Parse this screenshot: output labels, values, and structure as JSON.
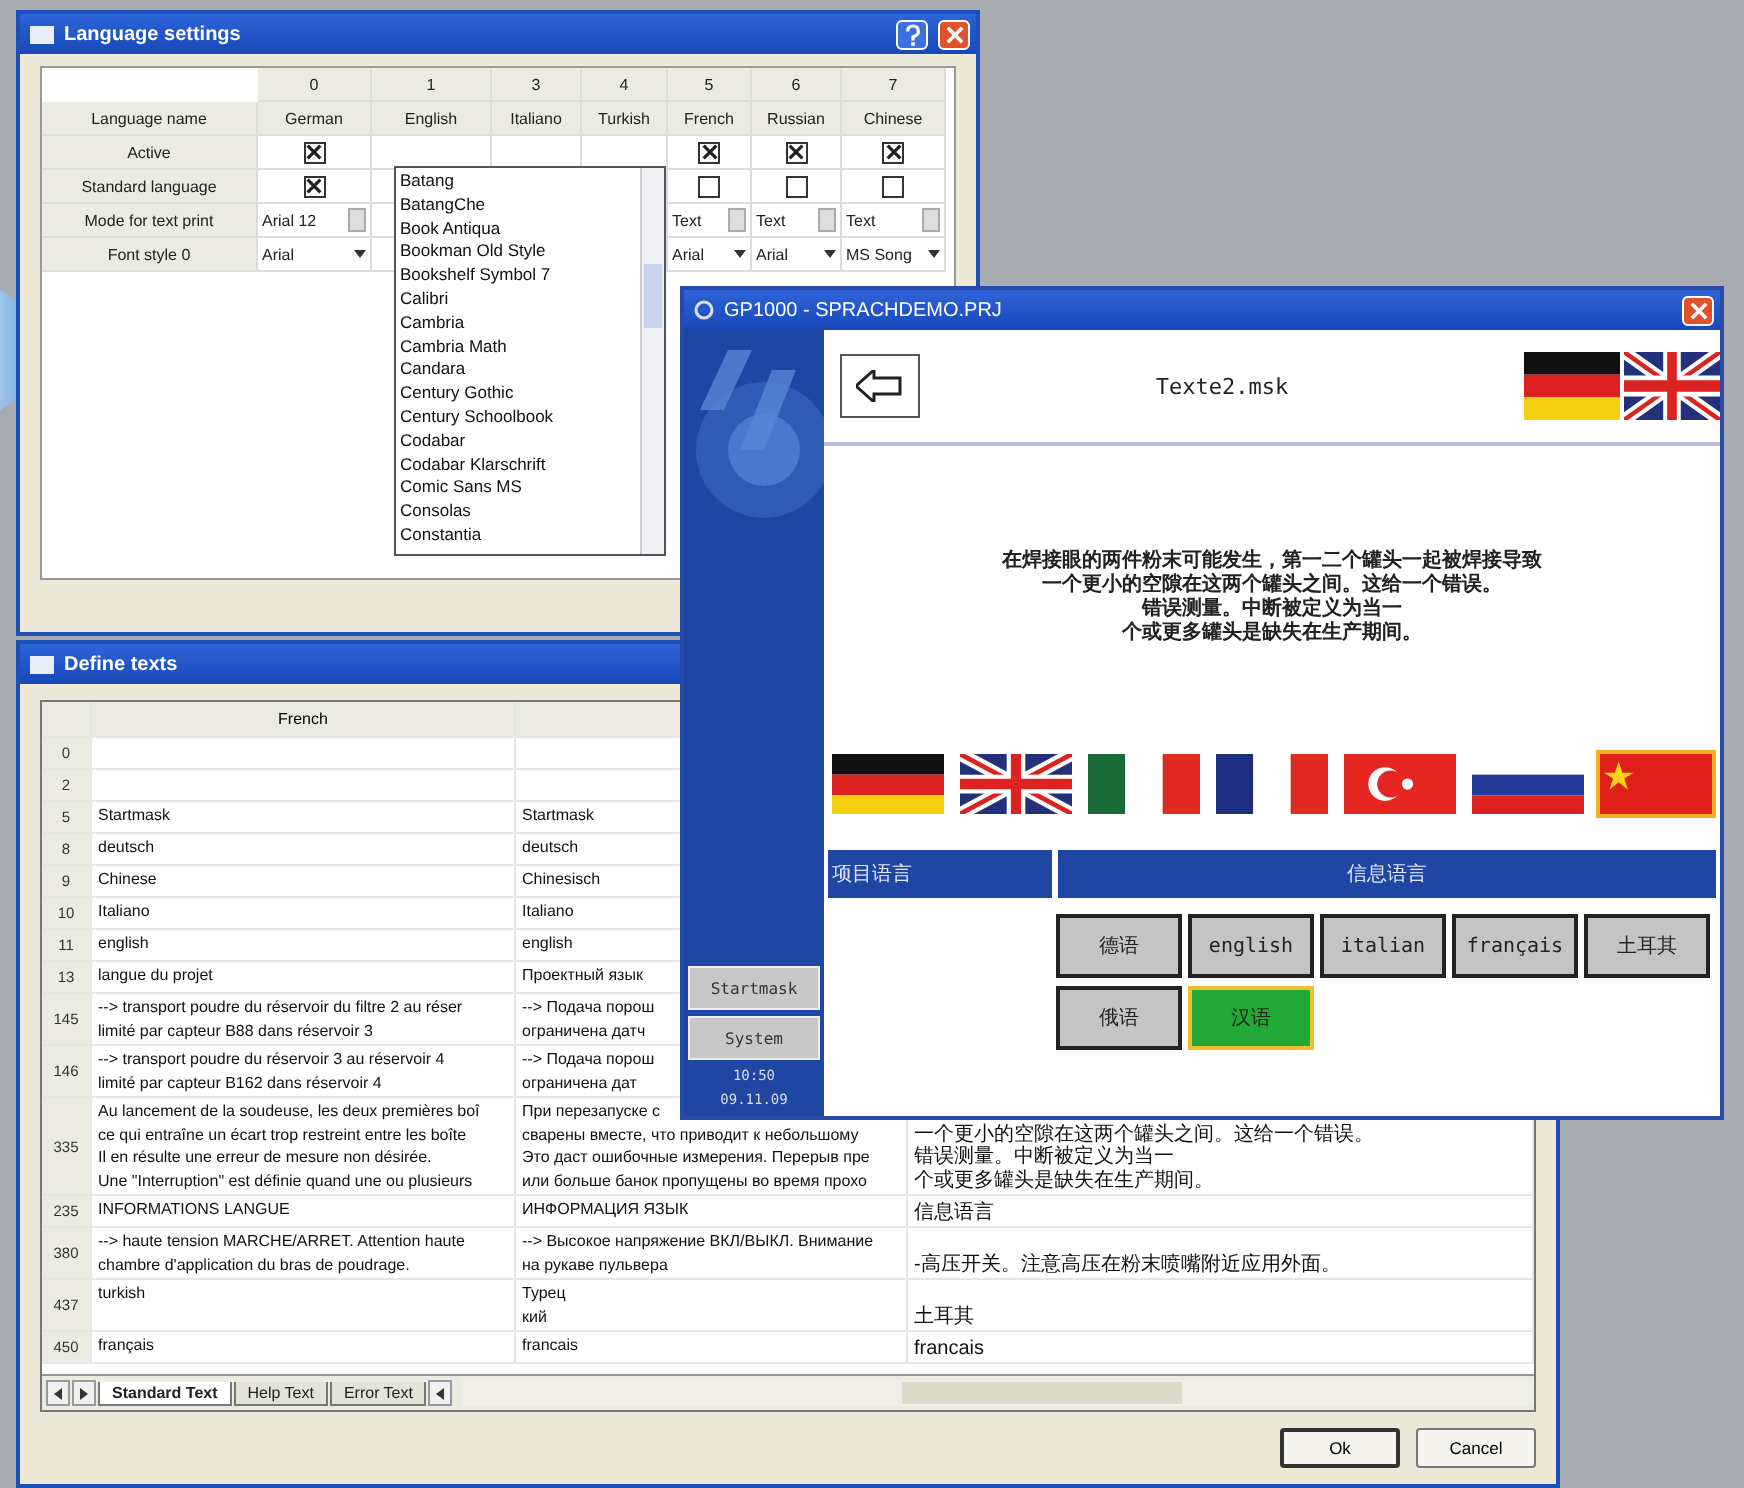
{
  "language_settings": {
    "title": "Language settings",
    "row_labels": [
      "Language name",
      "Active",
      "Standard language",
      "Mode for text print",
      "Font style 0"
    ],
    "columns": [
      {
        "number": "0",
        "name": "German",
        "active": true,
        "standard": true,
        "mode": "Arial 12",
        "font": "Arial"
      },
      {
        "number": "1",
        "name": "English"
      },
      {
        "number": "3",
        "name": "Italiano"
      },
      {
        "number": "4",
        "name": "Turkish"
      },
      {
        "number": "5",
        "name": "French",
        "active": true,
        "standard": false,
        "mode": "Text",
        "font": "Arial"
      },
      {
        "number": "6",
        "name": "Russian",
        "active": true,
        "standard": false,
        "mode": "Text",
        "font": "Arial"
      },
      {
        "number": "7",
        "name": "Chinese",
        "active": true,
        "standard": false,
        "mode": "Text",
        "font": "MS Song"
      }
    ],
    "font_list": [
      "Batang",
      "BatangChe",
      "Book Antiqua",
      "Bookman Old Style",
      "Bookshelf Symbol 7",
      "Calibri",
      "Cambria",
      "Cambria Math",
      "Candara",
      "Century Gothic",
      "Century Schoolbook",
      "Codabar",
      "Codabar Klarschrift",
      "Comic Sans MS",
      "Consolas",
      "Constantia"
    ]
  },
  "define_texts": {
    "title": "Define texts",
    "columns": [
      {
        "label": "French"
      }
    ],
    "rows": [
      {
        "number": "0",
        "cells": [
          [],
          [],
          []
        ]
      },
      {
        "number": "2",
        "cells": [
          [],
          [],
          []
        ]
      },
      {
        "number": "5",
        "cells": [
          [
            "Startmask"
          ],
          [
            "Startmask"
          ],
          []
        ]
      },
      {
        "number": "8",
        "cells": [
          [
            "deutsch"
          ],
          [
            "deutsch"
          ],
          []
        ]
      },
      {
        "number": "9",
        "cells": [
          [
            "Chinese"
          ],
          [
            "Chinesisch"
          ],
          []
        ]
      },
      {
        "number": "10",
        "cells": [
          [
            "Italiano"
          ],
          [
            "Italiano"
          ],
          []
        ]
      },
      {
        "number": "11",
        "cells": [
          [
            "english"
          ],
          [
            "english"
          ],
          []
        ]
      },
      {
        "number": "13",
        "cells": [
          [
            "langue du projet"
          ],
          [
            "Проектный язык"
          ],
          []
        ]
      },
      {
        "number": "145",
        "cells": [
          [
            "--> transport poudre du réservoir du filtre 2 au réser",
            "limité par capteur B88 dans réservoir 3"
          ],
          [
            "--> Подача порош",
            "ограничена датч"
          ],
          []
        ]
      },
      {
        "number": "146",
        "cells": [
          [
            "--> transport poudre du réservoir 3 au réservoir 4",
            "limité par capteur B162 dans réservoir 4"
          ],
          [
            "--> Подача порош",
            "ограничена дат"
          ],
          []
        ]
      },
      {
        "number": "335",
        "cells": [
          [
            "Au lancement de la soudeuse, les deux premières boî",
            "ce qui entraîne un écart trop restreint entre les boîte",
            "Il en résulte une erreur de mesure non désirée.",
            "Une \"Interruption\" est définie quand une ou plusieurs"
          ],
          [
            "При перезапуске с",
            "сварены вместе, что приводит к небольшому",
            "Это даст ошибочные измерения. Перерыв пре",
            "или больше банок пропущены во время прохо"
          ],
          [
            "一个更小的空隙在这两个罐头之间。这给一个错误。",
            "错误测量。中断被定义为当一",
            "个或更多罐头是缺失在生产期间。"
          ]
        ]
      },
      {
        "number": "235",
        "cells": [
          [
            "INFORMATIONS LANGUE"
          ],
          [
            "ИНФОРМАЦИЯ ЯЗЫК"
          ],
          [
            "信息语言"
          ]
        ]
      },
      {
        "number": "380",
        "cells": [
          [
            "--> haute tension MARCHE/ARRET. Attention haute",
            "chambre d'application du bras de poudrage."
          ],
          [
            "--> Высокое напряжение ВКЛ/ВЫКЛ. Внимание",
            "на рукаве пульвера"
          ],
          [
            "-高压开关。注意高压在粉末喷嘴附近应用外面。"
          ]
        ]
      },
      {
        "number": "437",
        "cells": [
          [
            "turkish"
          ],
          [
            "Турец",
            "кий"
          ],
          [
            "土耳其"
          ]
        ]
      },
      {
        "number": "450",
        "cells": [
          [
            "français"
          ],
          [
            "francais"
          ],
          [
            "francais"
          ]
        ]
      }
    ],
    "tabs": [
      {
        "label": "Standard Text",
        "selected": true
      },
      {
        "label": "Help Text",
        "selected": false
      },
      {
        "label": "Error Text",
        "selected": false
      }
    ],
    "buttons": [
      "Ok",
      "Cancel"
    ]
  },
  "gp1000": {
    "title": "GP1000 - SPRACHDEMO.PRJ",
    "side_buttons": [
      "Startmask",
      "System"
    ],
    "time": "10:50",
    "date": "09.11.09",
    "screen_title": "Texte2.msk",
    "header_flags": [
      {
        "kind": "de"
      },
      {
        "kind": "gb"
      }
    ],
    "message_lines": [
      "在焊接眼的两件粉末可能发生，第一二个罐头一起被焊接导致",
      "一个更小的空隙在这两个罐头之间。这给一个错误。",
      "错误测量。中断被定义为当一",
      "个或更多罐头是缺失在生产期间。"
    ],
    "flags": [
      {
        "kind": "de",
        "selected": false
      },
      {
        "kind": "gb",
        "selected": false
      },
      {
        "kind": "it",
        "selected": false
      },
      {
        "kind": "fr",
        "selected": false
      },
      {
        "kind": "tr",
        "selected": false
      },
      {
        "kind": "ru",
        "selected": false
      },
      {
        "kind": "cn",
        "selected": true
      }
    ],
    "project_language_label": "项目语言",
    "info_language_label": "信息语言",
    "language_buttons": [
      {
        "label": "德语",
        "selected": false
      },
      {
        "label": "english",
        "selected": false
      },
      {
        "label": "italian",
        "selected": false
      },
      {
        "label": "français",
        "selected": false
      },
      {
        "label": "土耳其",
        "selected": false
      },
      {
        "label": "俄语",
        "selected": false
      },
      {
        "label": "汉语",
        "selected": true
      }
    ]
  }
}
